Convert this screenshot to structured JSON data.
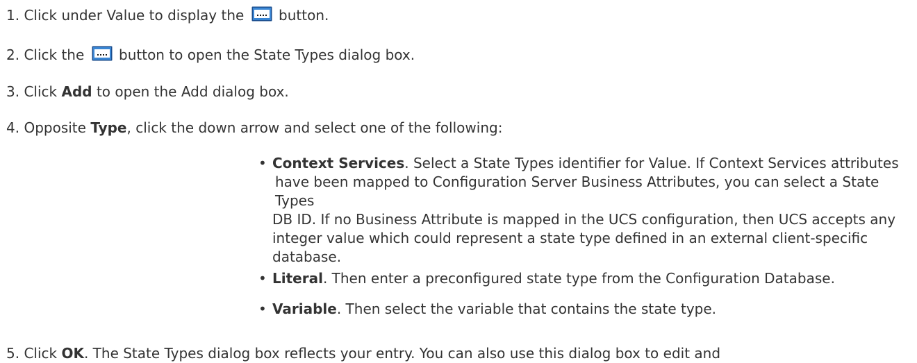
{
  "steps": [
    {
      "number": "1.",
      "text_before": "Click under Value to display the",
      "icon": "ellipsis-button-icon",
      "text_after": "button."
    },
    {
      "number": "2.",
      "text_before": "Click the",
      "icon": "ellipsis-button-icon",
      "text_after": "button to open the State Types dialog box."
    },
    {
      "number": "3.",
      "text_before": "Click",
      "bold": "Add",
      "text_after": "to open the Add dialog box."
    },
    {
      "number": "4.",
      "text_before": "Opposite",
      "bold": "Type",
      "text_after": ", click the down arrow and select one of the following:"
    },
    {
      "number": "5.",
      "text_before": "Click",
      "bold": "OK",
      "text_after": ". The State Types dialog box reflects your entry. You can also use this dialog box to edit and"
    }
  ],
  "bullets": [
    {
      "term": "Context Services",
      "lines": [
        ".  Select a State Types identifier for Value. If Context Services attributes",
        "have been mapped to Configuration Server Business Attributes, you can select a State Types",
        "DB ID. If no Business Attribute is mapped in the UCS configuration, then UCS accepts any",
        "integer value which could represent a state type defined in an external client-specific",
        "database."
      ]
    },
    {
      "term": "Literal",
      "lines": [
        ".  Then enter a preconfigured state type from the Configuration Database."
      ]
    },
    {
      "term": "Variable",
      "lines": [
        ". Then select the variable that contains the state type."
      ]
    }
  ],
  "colors": {
    "text": "#333333",
    "icon_fill": "#3a86d4",
    "icon_border": "#1c4f8f"
  }
}
